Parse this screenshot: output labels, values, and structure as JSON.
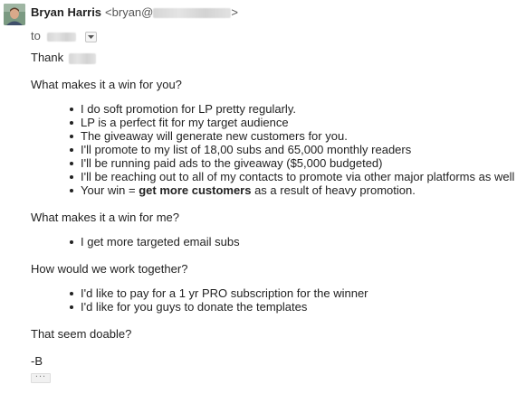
{
  "header": {
    "sender_name": "Bryan Harris",
    "sender_email_prefix": "<bryan@",
    "sender_email_suffix": ">",
    "to_label": "to"
  },
  "body": {
    "greeting": "Thank",
    "sections": [
      {
        "question": "What makes it a win for you?",
        "bullets": [
          "I do soft promotion for LP pretty regularly.",
          "LP is a perfect fit for my target audience",
          "The giveaway will generate new customers for you.",
          "I'll promote to my list of 18,00 subs and 65,000 monthly readers",
          "I'll be running paid ads to the giveaway ($5,000 budgeted)",
          "I'll be reaching out to all of my contacts to promote via other major platforms as well"
        ],
        "bullet_last": {
          "prefix": "Your win = ",
          "bold": "get more customers",
          "suffix": " as a result of heavy promotion."
        }
      },
      {
        "question": "What makes it a win for me?",
        "bullets": [
          "I get more targeted email subs"
        ]
      },
      {
        "question": "How would we work together?",
        "bullets": [
          "I'd like to pay for a 1 yr PRO subscription for the winner",
          "I'd like for you guys to donate the templates"
        ]
      }
    ],
    "closing_question": "That seem doable?",
    "signature": "-B"
  },
  "footer": {
    "show_trimmed_label": "..."
  }
}
